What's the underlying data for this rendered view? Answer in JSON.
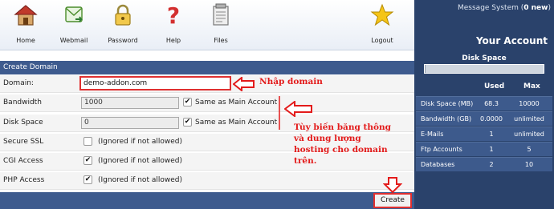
{
  "toolbar": {
    "home": "Home",
    "webmail": "Webmail",
    "password": "Password",
    "help": "Help",
    "files": "Files",
    "logout": "Logout"
  },
  "panel": {
    "title": "Create Domain"
  },
  "form": {
    "domain_label": "Domain:",
    "domain_value": "demo-addon.com",
    "bandwidth_label": "Bandwidth",
    "bandwidth_value": "1000",
    "bandwidth_same": "Same as Main Account",
    "diskspace_label": "Disk Space",
    "diskspace_value": "0",
    "diskspace_same": "Same as Main Account",
    "securessl_label": "Secure SSL",
    "securessl_note": "(Ignored if not allowed)",
    "cgi_label": "CGI Access",
    "cgi_note": "(Ignored if not allowed)",
    "php_label": "PHP Access",
    "php_note": "(Ignored if not allowed)",
    "create_label": "Create",
    "checks": {
      "bandwidth": true,
      "diskspace": true,
      "securessl": false,
      "cgi": true,
      "php": true
    }
  },
  "annotations": {
    "domain": "Nhập domain",
    "bandwidth_line1": "Tùy biến băng thông",
    "bandwidth_line2": "và dung lượng",
    "bandwidth_line3": "hosting cho domain",
    "bandwidth_line4": "trên."
  },
  "sidebar": {
    "message_system": "Message System (",
    "message_new": "0 new",
    "message_close": ")",
    "your_account": "Your Account",
    "disk_space_label": "Disk Space",
    "disk_usage_fraction": 0.0068,
    "col_used": "Used",
    "col_max": "Max",
    "stats": [
      {
        "name": "Disk Space (MB)",
        "used": "68.3",
        "max": "10000"
      },
      {
        "name": "Bandwidth (GB)",
        "used": "0.0000",
        "max": "unlimited"
      },
      {
        "name": "E-Mails",
        "used": "1",
        "max": "unlimited"
      },
      {
        "name": "Ftp Accounts",
        "used": "1",
        "max": "5"
      },
      {
        "name": "Databases",
        "used": "2",
        "max": "10"
      }
    ]
  },
  "colors": {
    "header_blue": "#3e5b8e",
    "sidebar_blue": "#2a426b",
    "annotation_red": "#e31b1b"
  }
}
